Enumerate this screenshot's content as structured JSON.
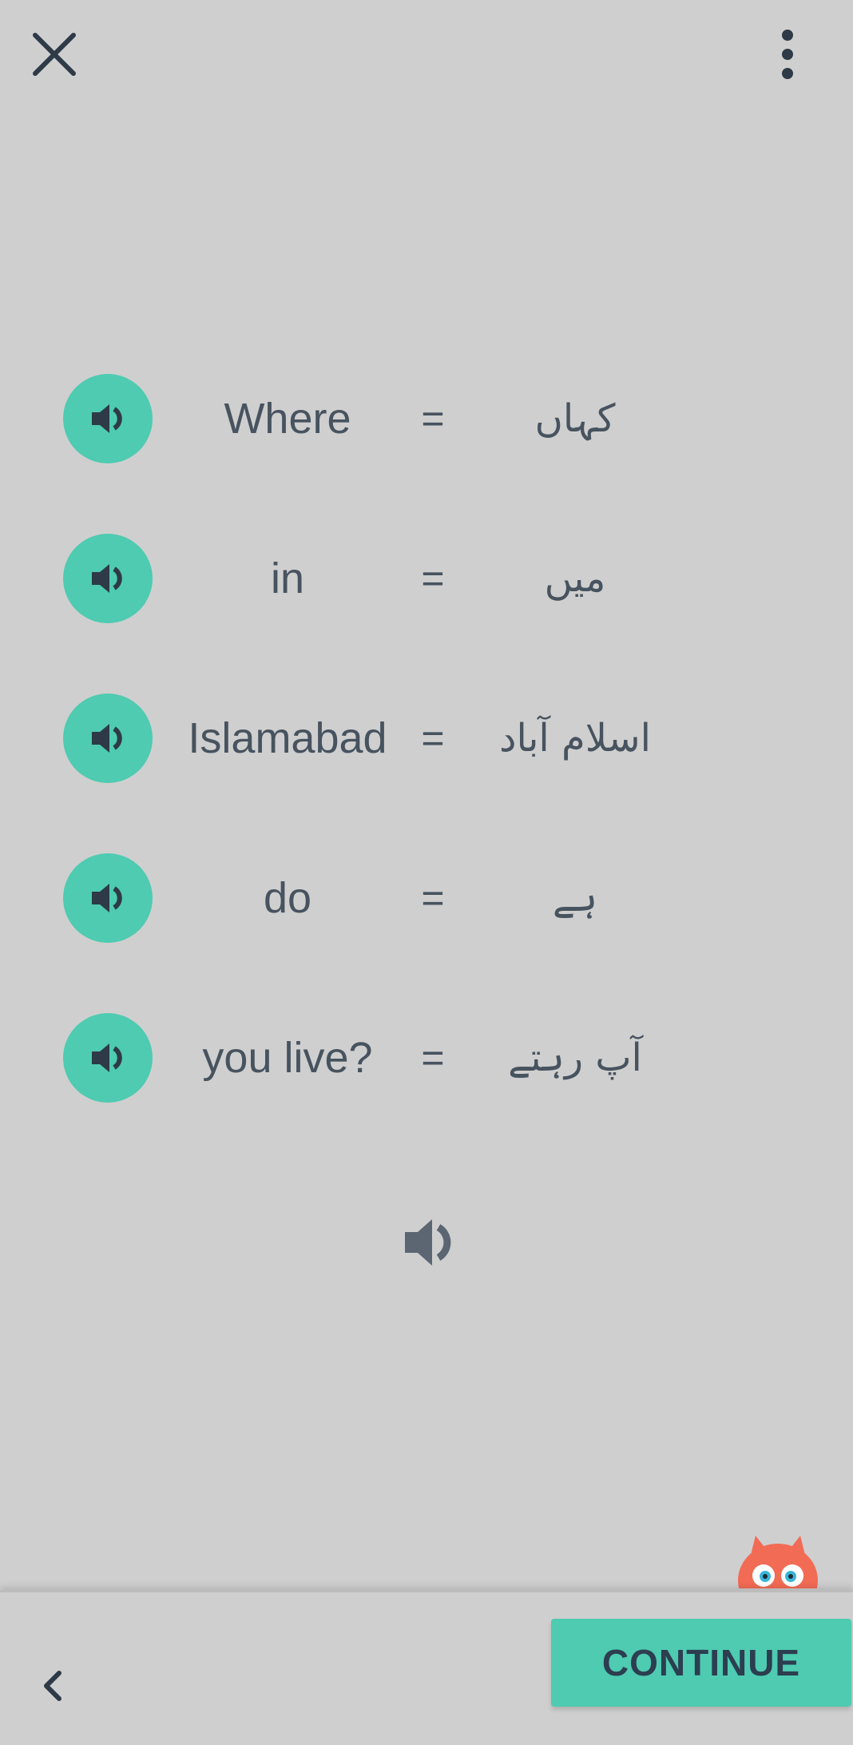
{
  "header": {
    "close_icon": "close-icon",
    "menu_icon": "more-vert-icon"
  },
  "rows": [
    {
      "english": "Where",
      "equals": "=",
      "urdu": "کہاں"
    },
    {
      "english": "in",
      "equals": "=",
      "urdu": "میں"
    },
    {
      "english": "Islamabad",
      "equals": "=",
      "urdu": "اسلام آباد"
    },
    {
      "english": "do",
      "equals": "=",
      "urdu": "ہے"
    },
    {
      "english": "you live?",
      "equals": "=",
      "urdu": "آپ رہتے"
    }
  ],
  "colors": {
    "background": "#cfcfcf",
    "accent": "#4ecbb1",
    "text": "#47535f"
  },
  "footer": {
    "continue_label": "CONTINUE",
    "back_icon": "chevron-left-icon"
  }
}
